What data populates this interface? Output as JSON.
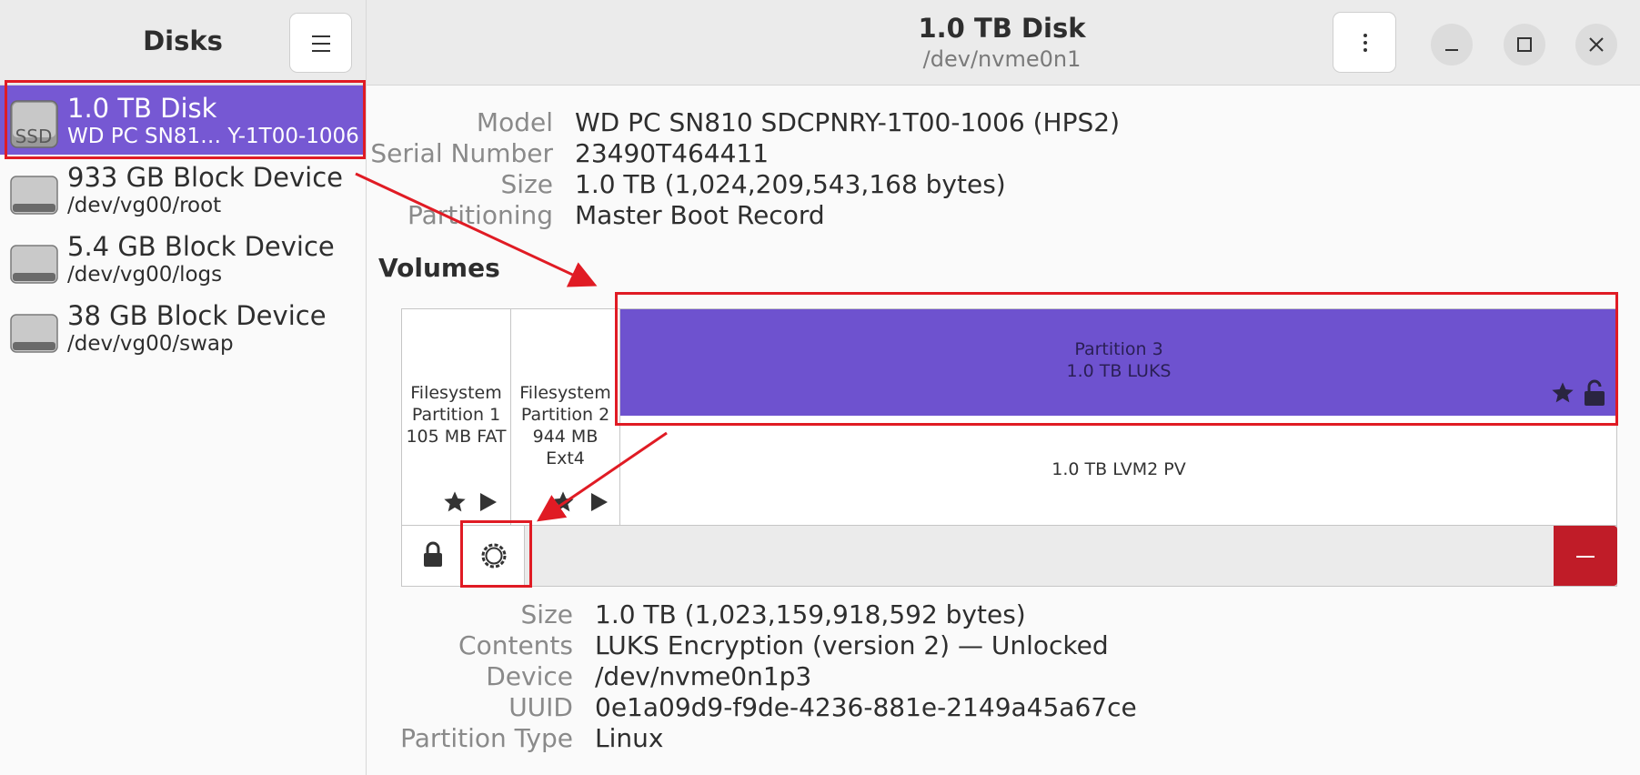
{
  "sidebar": {
    "title": "Disks",
    "items": [
      {
        "name": "1.0 TB Disk",
        "sub": "WD PC SN81…  Y-1T00-1006",
        "badge": "SSD"
      },
      {
        "name": "933 GB Block Device",
        "sub": "/dev/vg00/root"
      },
      {
        "name": "5.4 GB Block Device",
        "sub": "/dev/vg00/logs"
      },
      {
        "name": "38 GB Block Device",
        "sub": "/dev/vg00/swap"
      }
    ]
  },
  "header": {
    "title": "1.0 TB Disk",
    "subtitle": "/dev/nvme0n1"
  },
  "disk_info": {
    "model_label": "Model",
    "model_value": "WD PC SN810 SDCPNRY-1T00-1006 (HPS2)",
    "serial_label": "Serial Number",
    "serial_value": "23490T464411",
    "size_label": "Size",
    "size_value": "1.0 TB (1,024,209,543,168 bytes)",
    "partitioning_label": "Partitioning",
    "partitioning_value": "Master Boot Record"
  },
  "volumes": {
    "title": "Volumes",
    "p1": {
      "line1": "Filesystem",
      "line2": "Partition 1",
      "line3": "105 MB FAT"
    },
    "p2": {
      "line1": "Filesystem",
      "line2": "Partition 2",
      "line3": "944 MB Ext4"
    },
    "p3": {
      "line1": "Partition 3",
      "line2": "1.0 TB LUKS"
    },
    "lvm": "1.0 TB LVM2 PV"
  },
  "partition_info": {
    "size_label": "Size",
    "size_value": "1.0 TB (1,023,159,918,592 bytes)",
    "contents_label": "Contents",
    "contents_value": "LUKS Encryption (version 2) — Unlocked",
    "device_label": "Device",
    "device_value": "/dev/nvme0n1p3",
    "uuid_label": "UUID",
    "uuid_value": "0e1a09d9-f9de-4236-881e-2149a45a67ce",
    "type_label": "Partition Type",
    "type_value": "Linux"
  },
  "colors": {
    "accent": "#7658d3",
    "luks": "#6e52cf",
    "annotation": "#e01b24",
    "delete": "#c01c28"
  },
  "icons": [
    "hamburger-icon",
    "kebab-icon",
    "minimize-icon",
    "maximize-icon",
    "close-icon",
    "disk-icon",
    "star-icon",
    "play-icon",
    "unlocked-icon",
    "lock-icon",
    "gear-icon",
    "minus-icon"
  ]
}
